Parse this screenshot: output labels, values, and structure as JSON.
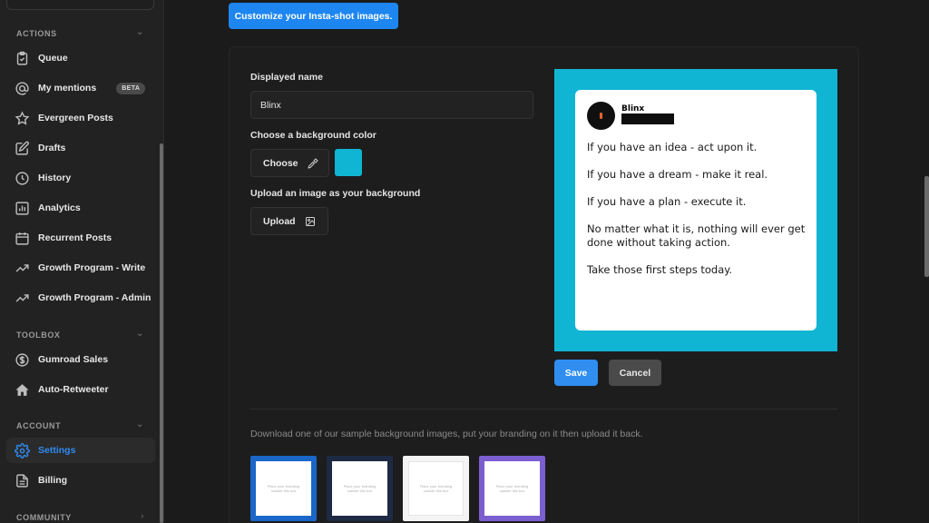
{
  "sidebar": {
    "sections": {
      "actions": "ACTIONS",
      "toolbox": "TOOLBOX",
      "account": "ACCOUNT",
      "community": "COMMUNITY"
    },
    "items": [
      {
        "label": "Queue",
        "icon": "clipboard-icon"
      },
      {
        "label": "My mentions",
        "icon": "at-icon",
        "badge": "BETA"
      },
      {
        "label": "Evergreen Posts",
        "icon": "star-icon"
      },
      {
        "label": "Drafts",
        "icon": "edit-icon"
      },
      {
        "label": "History",
        "icon": "clock-icon"
      },
      {
        "label": "Analytics",
        "icon": "analytics-icon"
      },
      {
        "label": "Recurrent Posts",
        "icon": "calendar-icon"
      },
      {
        "label": "Growth Program - Write",
        "icon": "trend-icon"
      },
      {
        "label": "Growth Program - Admin",
        "icon": "trend-icon"
      },
      {
        "label": "Gumroad Sales",
        "icon": "dollar-icon"
      },
      {
        "label": "Auto-Retweeter",
        "icon": "home-icon"
      },
      {
        "label": "Settings",
        "icon": "gear-icon",
        "active": true
      },
      {
        "label": "Billing",
        "icon": "document-icon"
      }
    ]
  },
  "main": {
    "customize_button": "Customize your Insta-shot images.",
    "displayed_name_label": "Displayed name",
    "displayed_name_value": "Blinx",
    "bg_color_label": "Choose a background color",
    "choose_button": "Choose",
    "bg_color": "#10b5d4",
    "upload_label": "Upload an image as your background",
    "upload_button": "Upload",
    "save_button": "Save",
    "cancel_button": "Cancel",
    "sample_text": "Download one of our sample background images, put your branding on it then upload it back.",
    "thumb_text": "Place your branding outside this box",
    "thumb_colors": [
      "#1a66c9",
      "#1e2a44",
      "#f4f4f4",
      "#7b5fd0"
    ]
  },
  "preview": {
    "name": "Blinx",
    "lines": [
      "If you have an idea - act upon it.",
      "If you have a dream - make it real.",
      "If you have a plan - execute it.",
      "No matter what it is, nothing will ever get",
      "done without taking action.",
      "Take those first steps today."
    ]
  }
}
